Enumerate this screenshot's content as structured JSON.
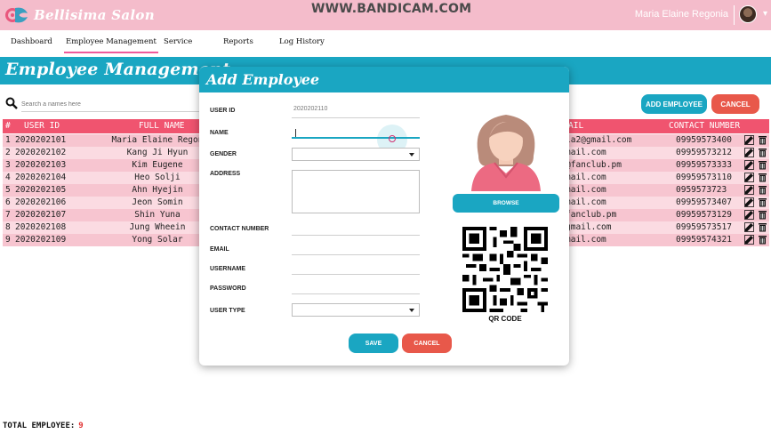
{
  "app": {
    "brand": "Bellisima Salon",
    "watermark": "WWW.BANDICAM.COM",
    "user_name": "Maria Elaine Regonia"
  },
  "nav": {
    "items": [
      {
        "label": "Dashboard"
      },
      {
        "label": "Employee Management"
      },
      {
        "label": "Service"
      },
      {
        "label": "Reports"
      },
      {
        "label": "Log History"
      }
    ],
    "active": "Employee Management"
  },
  "page": {
    "title": "Employee Management",
    "search_placeholder": "Search a names here",
    "add_button": "ADD EMPLOYEE",
    "cancel_button": "CANCEL"
  },
  "table": {
    "headers": {
      "num": "#",
      "user_id": "USER ID",
      "full_name": "FULL NAME",
      "email": "AIL",
      "contact": "CONTACT NUMBER"
    },
    "rows": [
      {
        "num": "1",
        "user_id": "2020202101",
        "full_name": "Maria Elaine Regon",
        "email": "ia2@gmail.com",
        "contact": "09959573400"
      },
      {
        "num": "2",
        "user_id": "2020202102",
        "full_name": "Kang Ji Hyun",
        "email": "mail.com",
        "contact": "09959573212"
      },
      {
        "num": "3",
        "user_id": "2020202103",
        "full_name": "Kim Eugene",
        "email": "@fanclub.pm",
        "contact": "09959573333"
      },
      {
        "num": "4",
        "user_id": "2020202104",
        "full_name": "Heo Solji",
        "email": "mail.com",
        "contact": "09959573110"
      },
      {
        "num": "5",
        "user_id": "2020202105",
        "full_name": "Ahn Hyejin",
        "email": "mail.com",
        "contact": "0959573723"
      },
      {
        "num": "6",
        "user_id": "2020202106",
        "full_name": "Jeon Somin",
        "email": "mail.com",
        "contact": "09959573407"
      },
      {
        "num": "7",
        "user_id": "2020202107",
        "full_name": "Shin Yuna",
        "email": "fanclub.pm",
        "contact": "09959573129"
      },
      {
        "num": "8",
        "user_id": "2020202108",
        "full_name": "Jung Wheein",
        "email": "gmail.com",
        "contact": "09959573517"
      },
      {
        "num": "9",
        "user_id": "2020202109",
        "full_name": "Yong Solar",
        "email": "mail.com",
        "contact": "09959574321"
      }
    ],
    "total_label": "TOTAL EMPLOYEE:",
    "total_value": "9"
  },
  "dialog": {
    "title": "Add Employee",
    "fields": {
      "user_id_label": "USER ID",
      "user_id_value": "2020202110",
      "name_label": "NAME",
      "gender_label": "GENDER",
      "address_label": "ADDRESS",
      "contact_label": "CONTACT NUMBER",
      "email_label": "EMAIL",
      "username_label": "USERNAME",
      "password_label": "PASSWORD",
      "user_type_label": "USER TYPE"
    },
    "browse_button": "BROWSE",
    "qr_label": "QR CODE",
    "save_button": "SAVE",
    "cancel_button": "CANCEL"
  },
  "colors": {
    "topbar": "#f4bccb",
    "accent": "#1aa6c2",
    "table_header": "#f0546f",
    "row_odd": "#f7c5d0",
    "row_even": "#fbdbe2",
    "cancel": "#e8584a"
  }
}
